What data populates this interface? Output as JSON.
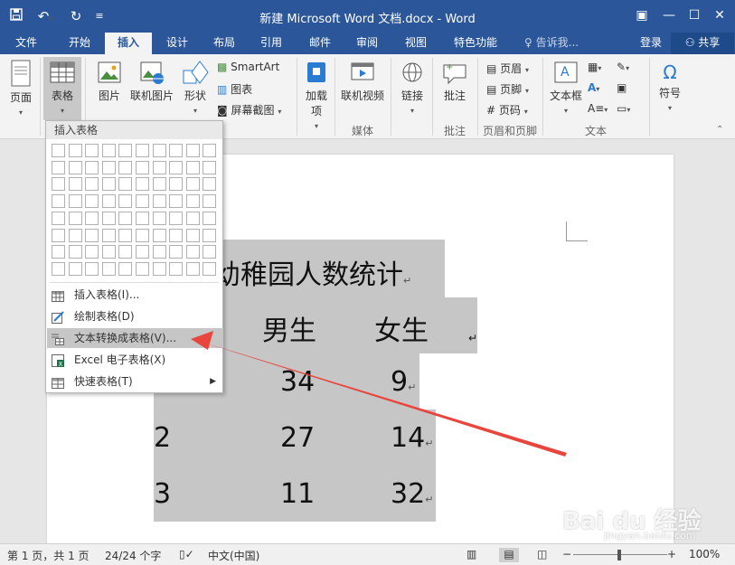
{
  "window": {
    "title": "新建 Microsoft Word 文档.docx - Word",
    "controls": [
      "▣",
      "—",
      "☐",
      "✕"
    ]
  },
  "tabs": [
    "文件",
    "开始",
    "插入",
    "设计",
    "布局",
    "引用",
    "邮件",
    "审阅",
    "视图",
    "特色功能"
  ],
  "active_tab": "插入",
  "tell_me": "告诉我...",
  "login": "登录",
  "share": "共享",
  "ribbon": {
    "page": "页面",
    "table": "表格",
    "picture": "图片",
    "online_picture": "联机图片",
    "shapes": "形状",
    "smartart": "SmartArt",
    "chart": "图表",
    "screenshot": "屏幕截图",
    "addins": "加载项",
    "online_video": "联机视频",
    "link": "链接",
    "comment": "批注",
    "header": "页眉",
    "footer": "页脚",
    "page_number": "页码",
    "textbox": "文本框",
    "symbol": "符号",
    "groups": {
      "media": "媒体",
      "comments": "批注",
      "header_footer": "页眉和页脚",
      "text": "文本"
    }
  },
  "dropdown": {
    "header": "插入表格",
    "items": [
      {
        "label": "插入表格(I)..."
      },
      {
        "label": "绘制表格(D)"
      },
      {
        "label": "文本转换成表格(V)..."
      },
      {
        "label": "Excel 电子表格(X)"
      },
      {
        "label": "快速表格(T)"
      }
    ]
  },
  "document": {
    "title": "幼稚园人数统计",
    "header_cols": [
      "男生",
      "女生"
    ],
    "rows": [
      {
        "a": "",
        "b": "34",
        "c": "9"
      },
      {
        "a": "2",
        "b": "27",
        "c": "14"
      },
      {
        "a": "3",
        "b": "11",
        "c": "32"
      }
    ],
    "para_mark": "↵"
  },
  "status": {
    "page": "第 1 页，共 1 页",
    "words": "24/24 个字",
    "language": "中文(中国)",
    "zoom": "100%"
  },
  "watermark": {
    "text": "Bai du 经验",
    "sub": "jingyan.baidu.com"
  },
  "colors": {
    "accent": "#2b579a",
    "arrow": "#e8453c"
  }
}
